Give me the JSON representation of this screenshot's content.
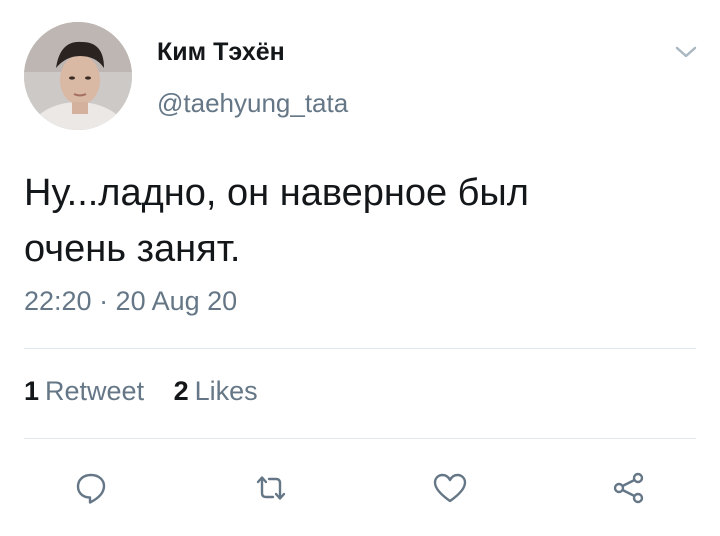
{
  "tweet": {
    "author": {
      "display_name": "Ким Тэхён",
      "handle": "@taehyung_tata"
    },
    "text_line1": "Ну...ладно, он наверное был",
    "text_line2": "очень занят.",
    "timestamp": "22:20 · 20 Aug 20"
  },
  "stats": {
    "retweets": {
      "count": "1",
      "label": "Retweet"
    },
    "likes": {
      "count": "2",
      "label": "Likes"
    }
  },
  "actions": [
    "reply-icon",
    "retweet-icon",
    "like-icon",
    "share-icon"
  ],
  "colors": {
    "text": "#14171a",
    "secondary_text": "#657786",
    "divider": "#e1e8ed",
    "icon": "#657786"
  }
}
